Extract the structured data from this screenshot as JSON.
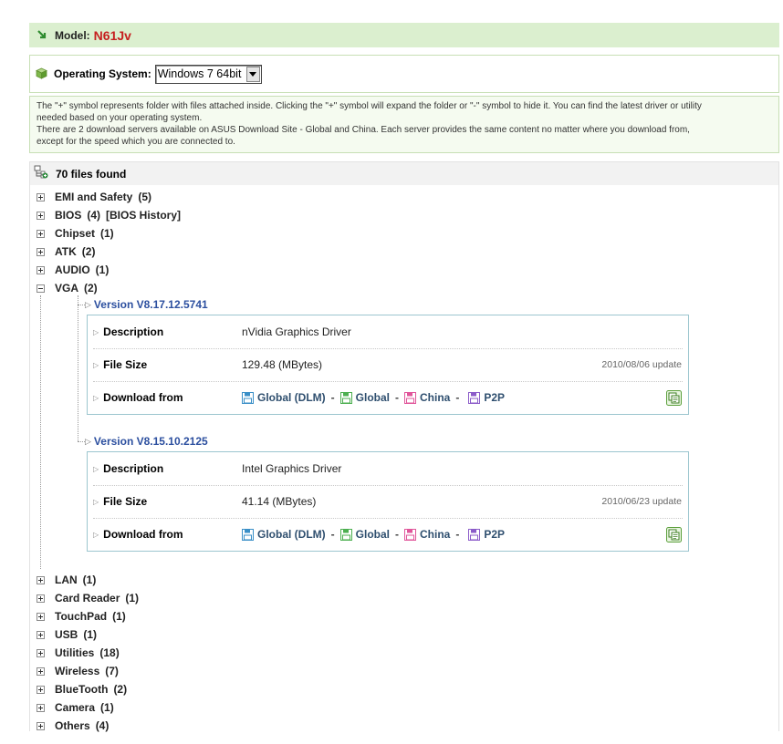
{
  "model": {
    "label": "Model:",
    "value": "N61Jv"
  },
  "os": {
    "label": "Operating System:",
    "selected": "Windows 7 64bit"
  },
  "info": {
    "line1": "The \"+\" symbol represents folder with files attached inside. Clicking the \"+\" symbol will expand the folder or \"-\" symbol to hide it. You can find the latest driver or utility",
    "line2": "needed based on your operating system.",
    "line3": "There are 2 download servers available on ASUS Download Site - Global and China. Each server provides the same content no matter where you download from,",
    "line4": "except for the speed which you are connected to."
  },
  "files_found": "70 files found",
  "categories_top": [
    {
      "name": "EMI and Safety",
      "count": "(5)"
    },
    {
      "name": "BIOS",
      "count": "(4)",
      "extra": "[BIOS History]"
    },
    {
      "name": "Chipset",
      "count": "(1)"
    },
    {
      "name": "ATK",
      "count": "(2)"
    },
    {
      "name": "AUDIO",
      "count": "(1)"
    },
    {
      "name": "VGA",
      "count": "(2)"
    }
  ],
  "vga_versions": [
    {
      "title": "Version V8.17.12.5741",
      "description_label": "Description",
      "description": "nVidia Graphics Driver",
      "filesize_label": "File Size",
      "filesize": "129.48 (MBytes)",
      "date": "2010/08/06 update",
      "download_label": "Download from"
    },
    {
      "title": "Version V8.15.10.2125",
      "description_label": "Description",
      "description": "Intel Graphics Driver",
      "filesize_label": "File Size",
      "filesize": "41.14 (MBytes)",
      "date": "2010/06/23 update",
      "download_label": "Download from"
    }
  ],
  "download_servers": [
    "Global (DLM)",
    "Global",
    "China",
    "P2P"
  ],
  "download_sep": "-",
  "server_colors": {
    "global_dlm": "#3a8fc7",
    "global": "#4caf50",
    "china": "#e0559a",
    "p2p": "#8b5bc9"
  },
  "categories_bottom": [
    {
      "name": "LAN",
      "count": "(1)"
    },
    {
      "name": "Card Reader",
      "count": "(1)"
    },
    {
      "name": "TouchPad",
      "count": "(1)"
    },
    {
      "name": "USB",
      "count": "(1)"
    },
    {
      "name": "Utilities",
      "count": "(18)"
    },
    {
      "name": "Wireless",
      "count": "(7)"
    },
    {
      "name": "BlueTooth",
      "count": "(2)"
    },
    {
      "name": "Camera",
      "count": "(1)"
    },
    {
      "name": "Others",
      "count": "(4)"
    }
  ],
  "colors": {
    "accent_green": "#dbefcf",
    "model_red": "#c62020",
    "version_blue": "#2c4f9f",
    "box_border": "#9cc6cf"
  }
}
